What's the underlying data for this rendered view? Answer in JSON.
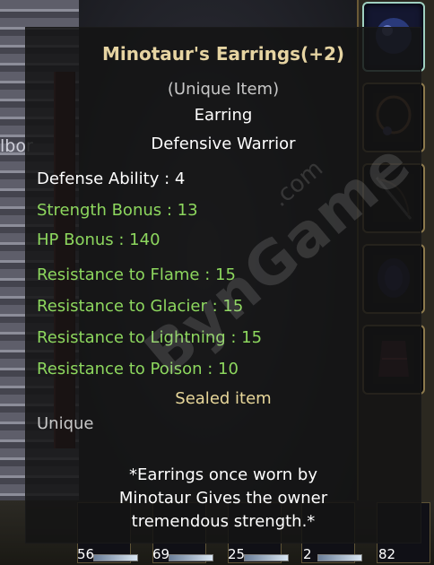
{
  "background": {
    "left_label": "lbor"
  },
  "tooltip": {
    "title": "Minotaur's Earrings(+2)",
    "rarity_tag": "(Unique Item)",
    "item_type": "Earring",
    "item_class": "Defensive Warrior",
    "defense": "Defense Ability : 4",
    "stats": [
      "Strength Bonus : 13",
      "HP Bonus : 140",
      "Resistance to Flame : 15",
      "Resistance to Glacier : 15",
      "Resistance to Lightning : 15",
      "Resistance to Poison : 10"
    ],
    "sealed": "Sealed item",
    "grade": "Unique",
    "description": [
      "*Earrings once worn by",
      "Minotaur Gives the owner",
      "tremendous strength.*"
    ]
  },
  "watermark": {
    "main": "BynGame",
    "small": ".com"
  },
  "hotbar": {
    "counts": [
      "56",
      "69",
      "25",
      "2",
      "82"
    ]
  },
  "icons": {
    "slot_1": "earring-icon",
    "slot_2": "necklace-icon",
    "slot_3": "bow-icon",
    "slot_4": "ring-icon",
    "slot_5": "belt-icon"
  },
  "colors": {
    "title": "#e6d4a2",
    "stat_bonus": "#8dd75e",
    "sealed": "#e8d79a"
  }
}
